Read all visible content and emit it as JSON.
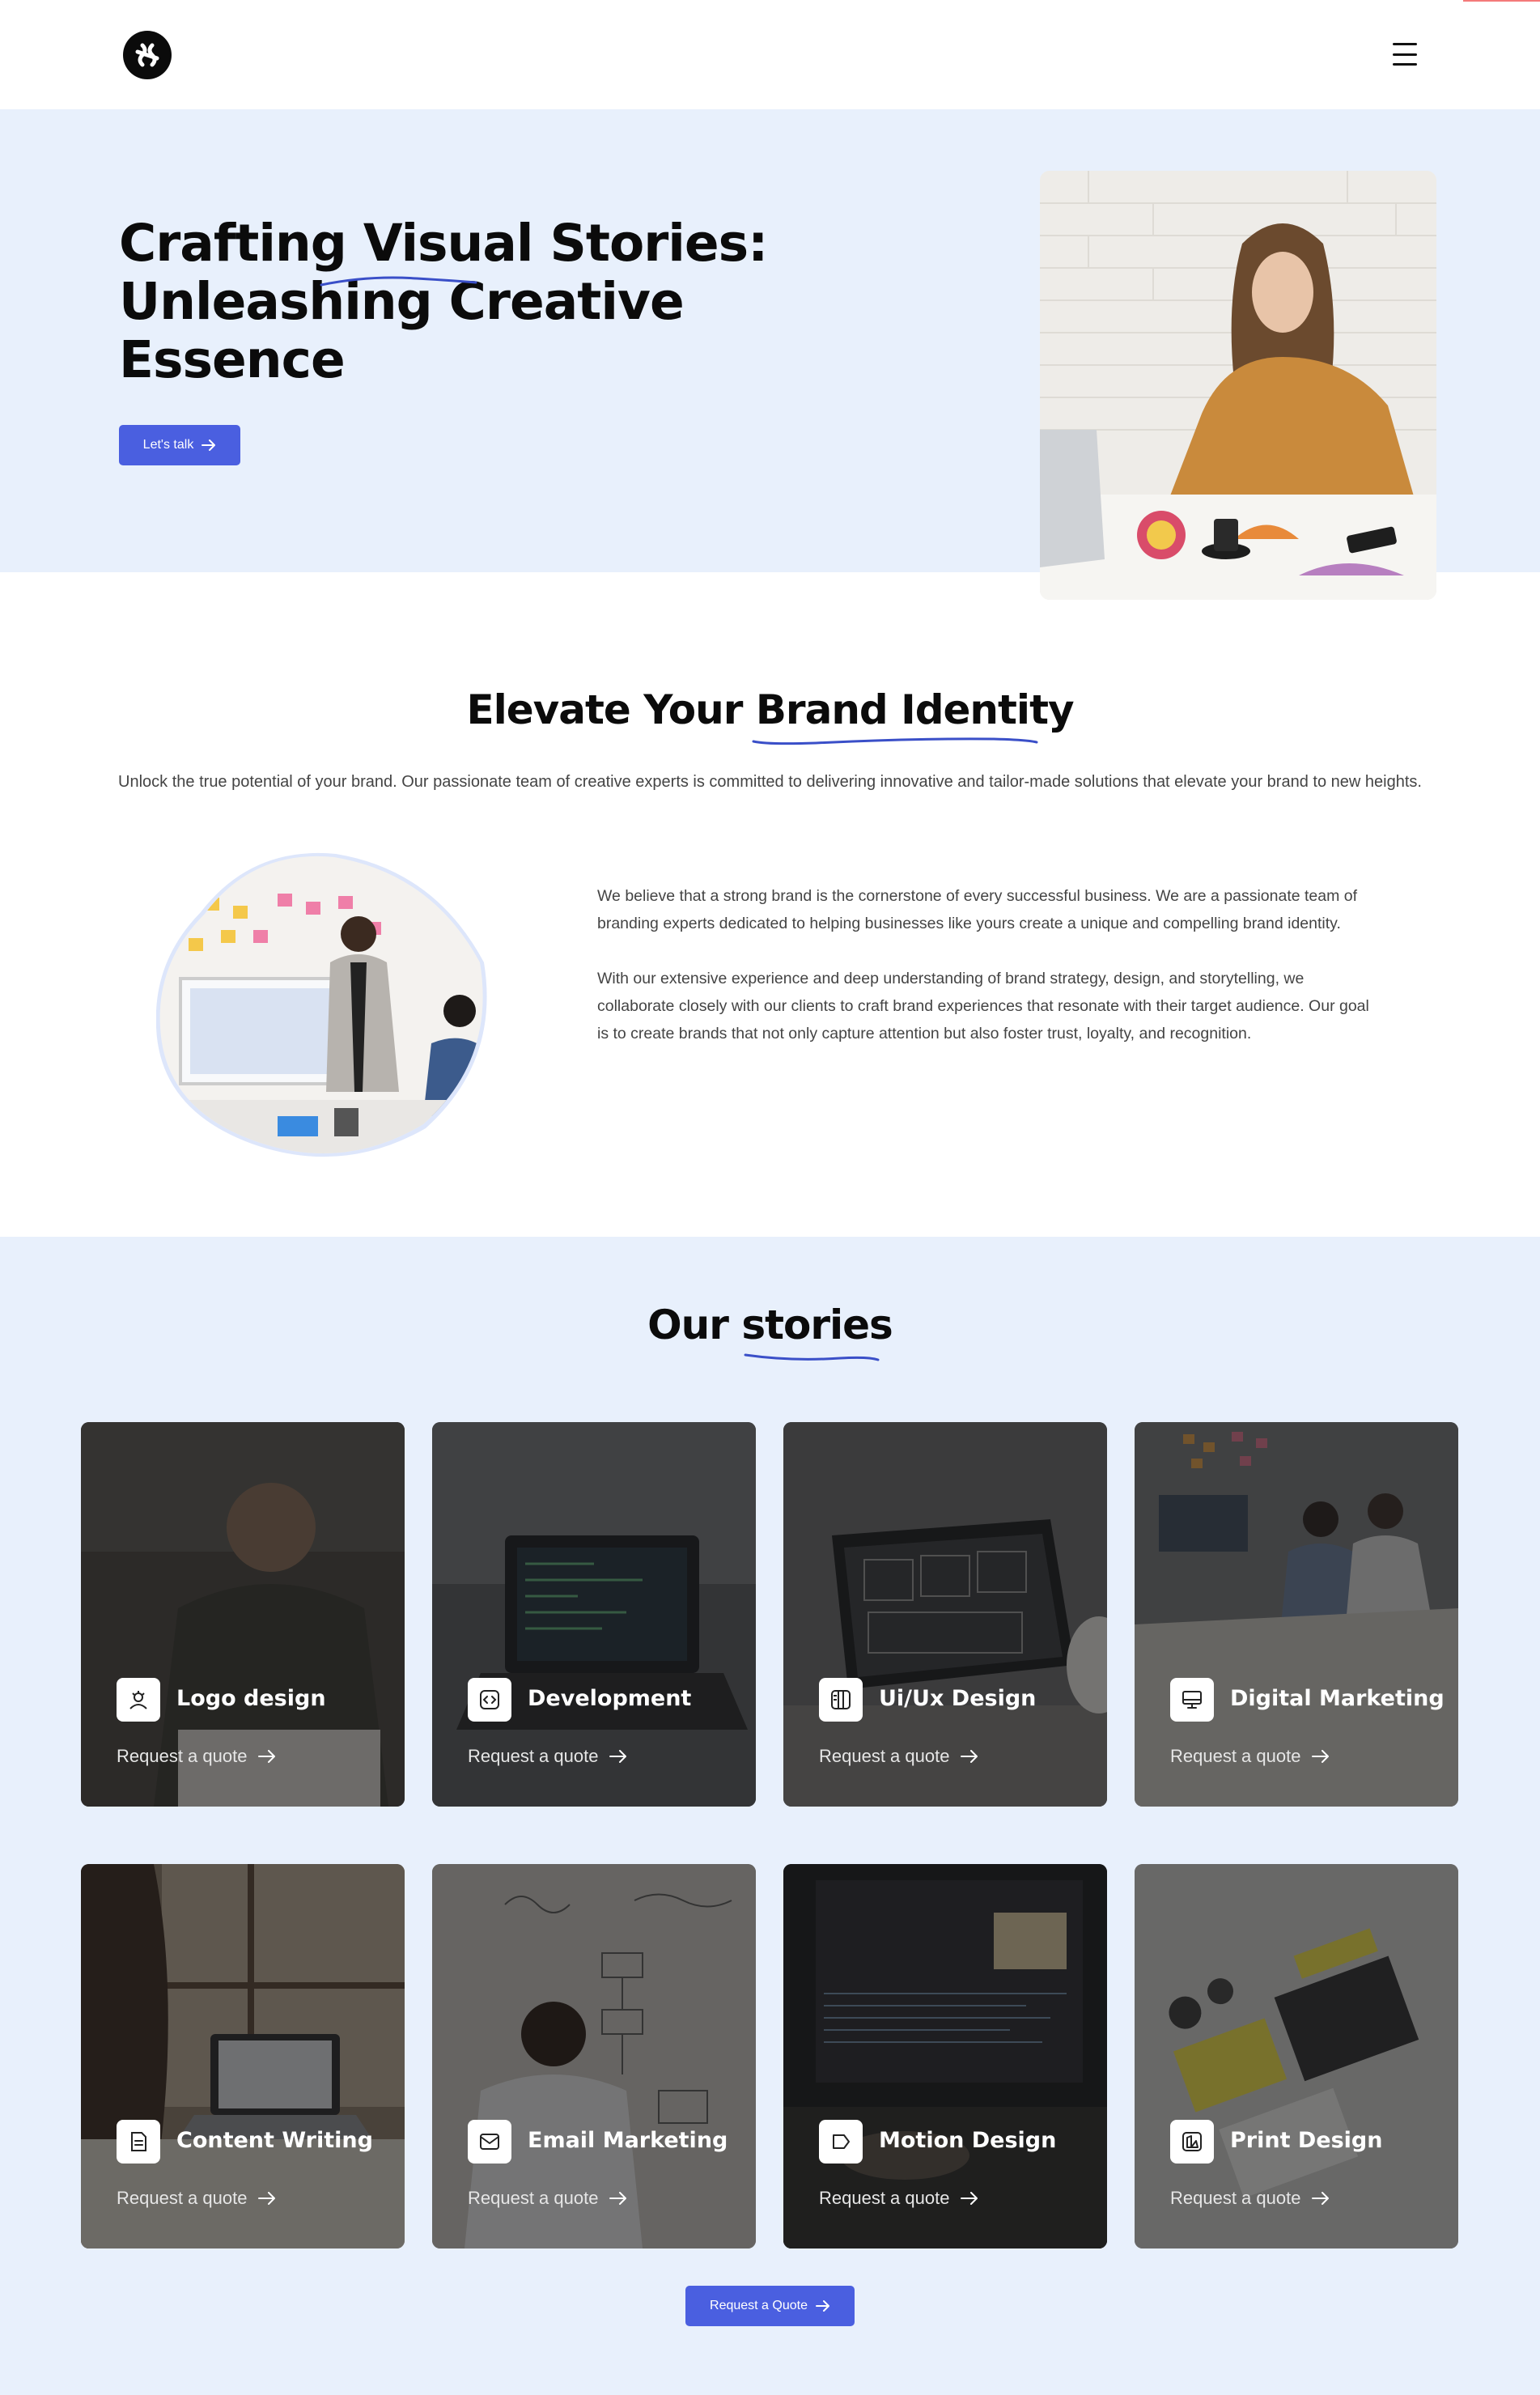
{
  "header": {
    "logo_icon": "brand-logo-icon",
    "menu_icon": "hamburger-menu-icon"
  },
  "hero": {
    "title_lines": [
      "Crafting Visual Stories:",
      "Unleashing Creative",
      "Essence"
    ],
    "cta_label": "Let's talk",
    "cta_icon": "arrow-right-icon",
    "image": "woman-working-with-color-swatches-photo"
  },
  "elevate": {
    "title": "Elevate Your Brand Identity",
    "intro": "Unlock the true potential of your brand. Our passionate team of creative experts is committed to delivering innovative and tailor-made solutions that elevate your brand to new heights.",
    "paragraphs": [
      "We believe that a strong brand is the cornerstone of every successful business. We are a passionate team of branding experts dedicated to helping businesses like yours create a unique and compelling brand identity.",
      "With our extensive experience and deep understanding of brand strategy, design, and storytelling, we collaborate closely with our clients to craft brand experiences that resonate with their target audience. Our goal is to create brands that not only capture attention but also foster trust, loyalty, and recognition."
    ],
    "image": "team-meeting-presentation-photo"
  },
  "stories": {
    "title": "Our stories",
    "cards": [
      {
        "title": "Logo design",
        "quote": "Request a quote",
        "icon": "logo-design-icon"
      },
      {
        "title": "Development",
        "quote": "Request a quote",
        "icon": "code-icon"
      },
      {
        "title": "Ui/Ux Design",
        "quote": "Request a quote",
        "icon": "ui-ux-icon"
      },
      {
        "title": "Digital Marketing",
        "quote": "Request a quote",
        "icon": "monitor-icon"
      },
      {
        "title": "Content Writing",
        "quote": "Request a quote",
        "icon": "document-icon"
      },
      {
        "title": "Email Marketing",
        "quote": "Request a quote",
        "icon": "email-icon"
      },
      {
        "title": "Motion Design",
        "quote": "Request a quote",
        "icon": "motion-tag-icon"
      },
      {
        "title": "Print Design",
        "quote": "Request a quote",
        "icon": "print-design-icon"
      }
    ],
    "cta_label": "Request a Quote"
  },
  "colors": {
    "accent": "#4a5fe0",
    "hero_bg": "#e8f0fc",
    "text": "#0b0b0b"
  }
}
